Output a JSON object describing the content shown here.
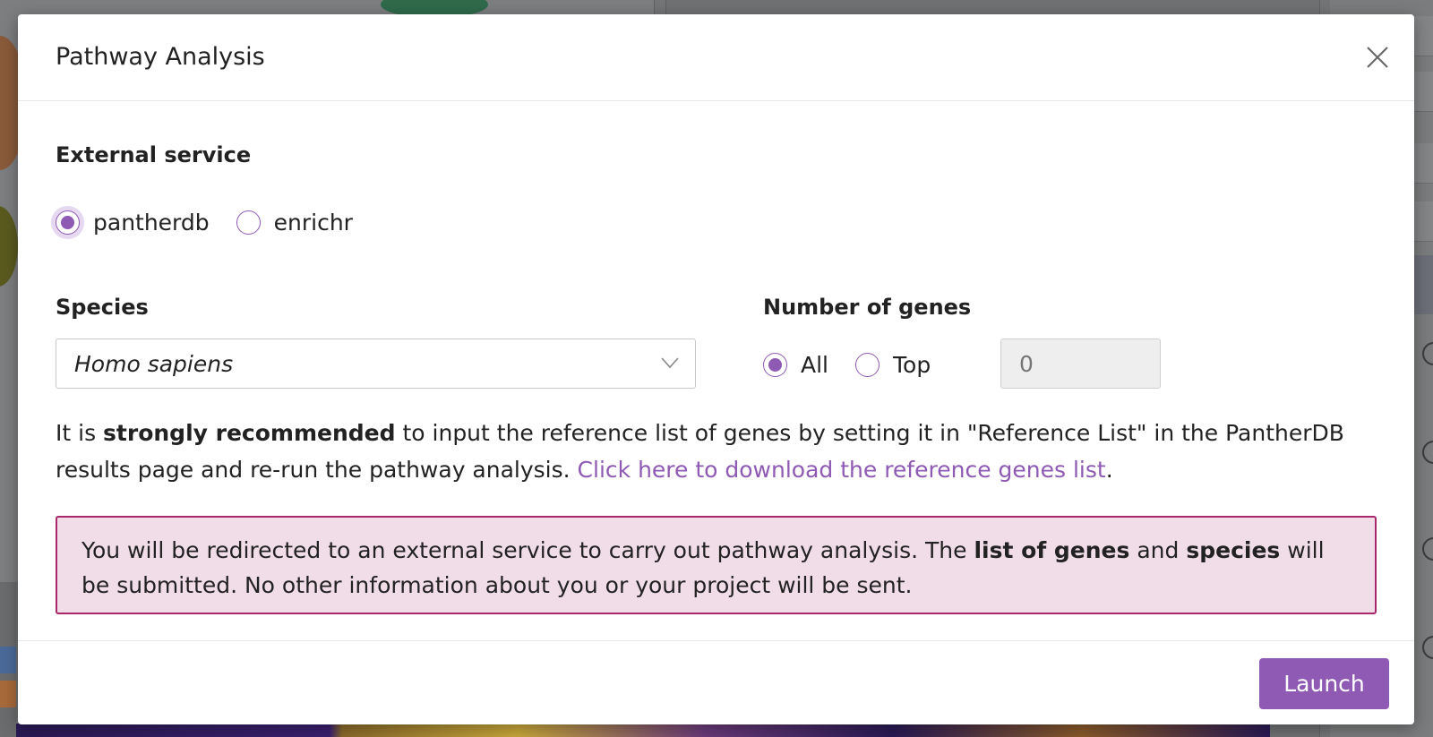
{
  "modal": {
    "title": "Pathway Analysis",
    "close_icon": "close-icon"
  },
  "external_service": {
    "label": "External service",
    "options": [
      {
        "label": "pantherdb",
        "selected": true
      },
      {
        "label": "enrichr",
        "selected": false
      }
    ]
  },
  "species": {
    "label": "Species",
    "selected": "Homo sapiens",
    "chevron_icon": "chevron-down-icon"
  },
  "number_of_genes": {
    "label": "Number of genes",
    "options": [
      {
        "label": "All",
        "selected": true
      },
      {
        "label": "Top",
        "selected": false
      }
    ],
    "top_value_placeholder": "0"
  },
  "recommendation": {
    "prefix": "It is ",
    "bold": "strongly recommended",
    "middle": " to input the reference list of genes by setting it in \"Reference List\" in the PantherDB results page and re-run the pathway analysis. ",
    "link": "Click here to download the reference genes list",
    "suffix": "."
  },
  "alert": {
    "part1": "You will be redirected to an external service to carry out pathway analysis. The ",
    "bold1": "list of genes",
    "part2": " and ",
    "bold2": "species",
    "part3": " will be submitted. No other information about you or your project will be sent."
  },
  "footer": {
    "launch_label": "Launch"
  },
  "colors": {
    "accent": "#8e5ab4",
    "alert_border": "#a8286b",
    "alert_background": "#f1dde8"
  }
}
